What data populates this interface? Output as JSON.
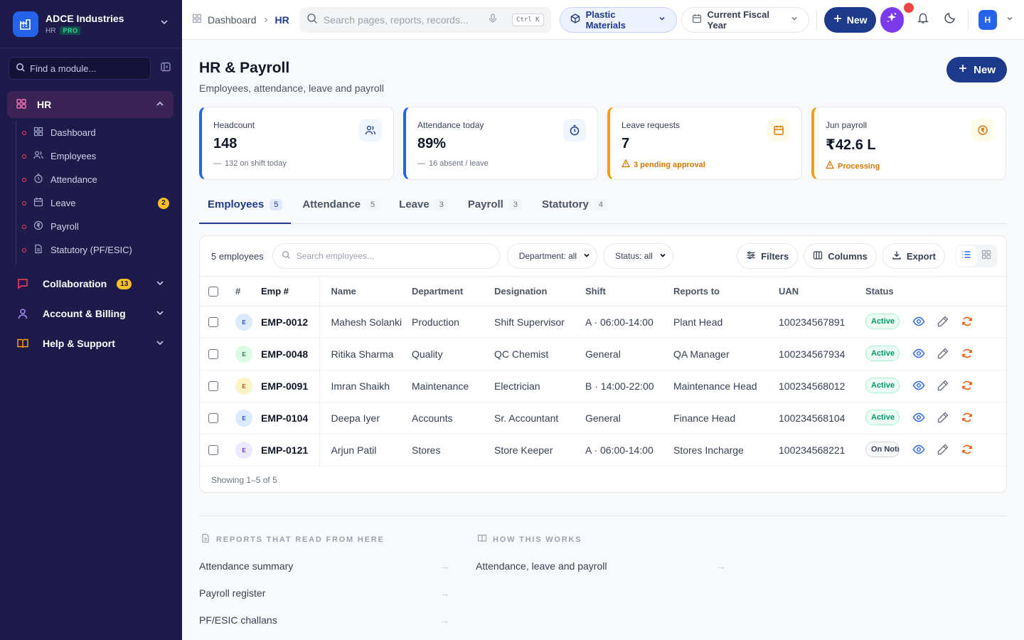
{
  "app": {
    "company": "ADCE Industries",
    "module": "HR",
    "plan": "PRO",
    "find_placeholder": "Find a module..."
  },
  "sidebar": {
    "active_group": "HR",
    "items": [
      {
        "label": "Dashboard",
        "icon": "dashboard-icon"
      },
      {
        "label": "Employees",
        "icon": "users-icon"
      },
      {
        "label": "Attendance",
        "icon": "clock-icon"
      },
      {
        "label": "Leave",
        "icon": "calendar-icon",
        "badge": "2"
      },
      {
        "label": "Payroll",
        "icon": "coin-icon"
      },
      {
        "label": "Statutory (PF/ESIC)",
        "icon": "document-icon"
      }
    ],
    "sections": [
      {
        "label": "Collaboration",
        "badge": "13",
        "icon": "chat-icon",
        "color": "#f43f5e"
      },
      {
        "label": "Account & Billing",
        "icon": "user-icon",
        "color": "#8b5cf6"
      },
      {
        "label": "Help & Support",
        "icon": "book-icon",
        "color": "#f59e0b"
      }
    ]
  },
  "topbar": {
    "breadcrumb": [
      "Dashboard",
      "HR"
    ],
    "search_placeholder": "Search pages, reports, records...",
    "shortcut": "Ctrl K",
    "company_filter": "Plastic Materials",
    "period_filter": "Current Fiscal Year",
    "new_label": "New",
    "user_initial": "H"
  },
  "page": {
    "title": "HR & Payroll",
    "subtitle": "Employees, attendance, leave and payroll",
    "new_label": "New"
  },
  "kpis": [
    {
      "label": "Headcount",
      "value": "148",
      "note": "132 on shift today",
      "note_type": "neutral",
      "color": "#2563eb",
      "icon": "users-icon"
    },
    {
      "label": "Attendance today",
      "value": "89%",
      "note": "16 absent / leave",
      "note_type": "neutral",
      "color": "#2563eb",
      "icon": "stopwatch-icon"
    },
    {
      "label": "Leave requests",
      "value": "7",
      "note": "3 pending approval",
      "note_type": "warning",
      "color": "#f59e0b",
      "icon": "calendar-icon"
    },
    {
      "label": "Jun payroll",
      "value": "₹42.6 L",
      "note": "Processing",
      "note_type": "warning",
      "color": "#f59e0b",
      "icon": "coin-icon"
    }
  ],
  "tabs": [
    {
      "label": "Employees",
      "count": "5",
      "active": true
    },
    {
      "label": "Attendance",
      "count": "5"
    },
    {
      "label": "Leave",
      "count": "3"
    },
    {
      "label": "Payroll",
      "count": "3"
    },
    {
      "label": "Statutory",
      "count": "4"
    }
  ],
  "toolbar": {
    "count_text": "5 employees",
    "search_placeholder": "Search employees...",
    "department_filter": "Department: all",
    "status_filter": "Status: all",
    "filters_label": "Filters",
    "columns_label": "Columns",
    "export_label": "Export"
  },
  "table": {
    "headers": [
      "#",
      "Emp #",
      "Name",
      "Department",
      "Designation",
      "Shift",
      "Reports to",
      "UAN",
      "Status"
    ],
    "rows": [
      {
        "avatar": "E",
        "avatar_color": "#dbeafe",
        "avatar_text": "#1d4ed8",
        "id": "EMP-0012",
        "name": "Mahesh Solanki",
        "department": "Production",
        "designation": "Shift Supervisor",
        "shift": "A · 06:00-14:00",
        "reports_to": "Plant Head",
        "uan": "100234567891",
        "status": "Active",
        "status_type": "active"
      },
      {
        "avatar": "E",
        "avatar_color": "#dcfce7",
        "avatar_text": "#15803d",
        "id": "EMP-0048",
        "name": "Ritika Sharma",
        "department": "Quality",
        "designation": "QC Chemist",
        "shift": "General",
        "reports_to": "QA Manager",
        "uan": "100234567934",
        "status": "Active",
        "status_type": "active"
      },
      {
        "avatar": "E",
        "avatar_color": "#fef3c7",
        "avatar_text": "#b45309",
        "id": "EMP-0091",
        "name": "Imran Shaikh",
        "department": "Maintenance",
        "designation": "Electrician",
        "shift": "B · 14:00-22:00",
        "reports_to": "Maintenance Head",
        "uan": "100234568012",
        "status": "Active",
        "status_type": "active"
      },
      {
        "avatar": "E",
        "avatar_color": "#dbeafe",
        "avatar_text": "#1d4ed8",
        "id": "EMP-0104",
        "name": "Deepa Iyer",
        "department": "Accounts",
        "designation": "Sr. Accountant",
        "shift": "General",
        "reports_to": "Finance Head",
        "uan": "100234568104",
        "status": "Active",
        "status_type": "active"
      },
      {
        "avatar": "E",
        "avatar_color": "#ede9fe",
        "avatar_text": "#6d28d9",
        "id": "EMP-0121",
        "name": "Arjun Patil",
        "department": "Stores",
        "designation": "Store Keeper",
        "shift": "A · 06:00-14:00",
        "reports_to": "Stores Incharge",
        "uan": "100234568221",
        "status": "On Notice",
        "status_type": "notice"
      }
    ],
    "footer": "Showing 1–5 of 5"
  },
  "bottom": {
    "reports_heading": "REPORTS THAT READ FROM HERE",
    "reports": [
      "Attendance summary",
      "Payroll register",
      "PF/ESIC challans"
    ],
    "how_heading": "HOW THIS WORKS",
    "how": [
      "Attendance, leave and payroll"
    ]
  }
}
